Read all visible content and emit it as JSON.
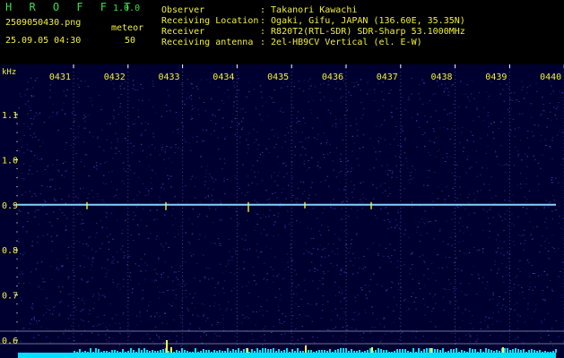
{
  "header": {
    "app_title": "H R O F F T",
    "version": "1.0.0",
    "filename": "2509050430.png",
    "datetime": "25.09.05 04:30",
    "mode_label": "meteor",
    "count": "50",
    "info_labels": [
      "Observer",
      "Receiving Location",
      "Receiver",
      "Receiving antenna"
    ],
    "info_values": [
      ": Takanori Kawachi",
      ": Ogaki, Gifu, JAPAN (136.60E, 35.35N)",
      ": R820T2(RTL-SDR) SDR-Sharp 53.1000MHz",
      ": 2el-HB9CV Vertical (el. E-W)"
    ]
  },
  "spectrogram": {
    "unit_label": "kHz",
    "y_ticks": [
      "1.1",
      "1.0",
      "0.9",
      "0.8",
      "0.7",
      "0.6"
    ],
    "time_ticks": [
      "0431",
      "0432",
      "0433",
      "0434",
      "0435",
      "0436",
      "0437",
      "0438",
      "0439",
      "0440"
    ],
    "carrier_khz": 0.9,
    "colors": {
      "background": "#000030",
      "noise": "#2a3aa0",
      "carrier": "#7fd4ff",
      "signal_bar": "#00e0ff",
      "spike": "#ffff40",
      "text": "#f0ef3a",
      "tick": "#ffffff"
    }
  }
}
